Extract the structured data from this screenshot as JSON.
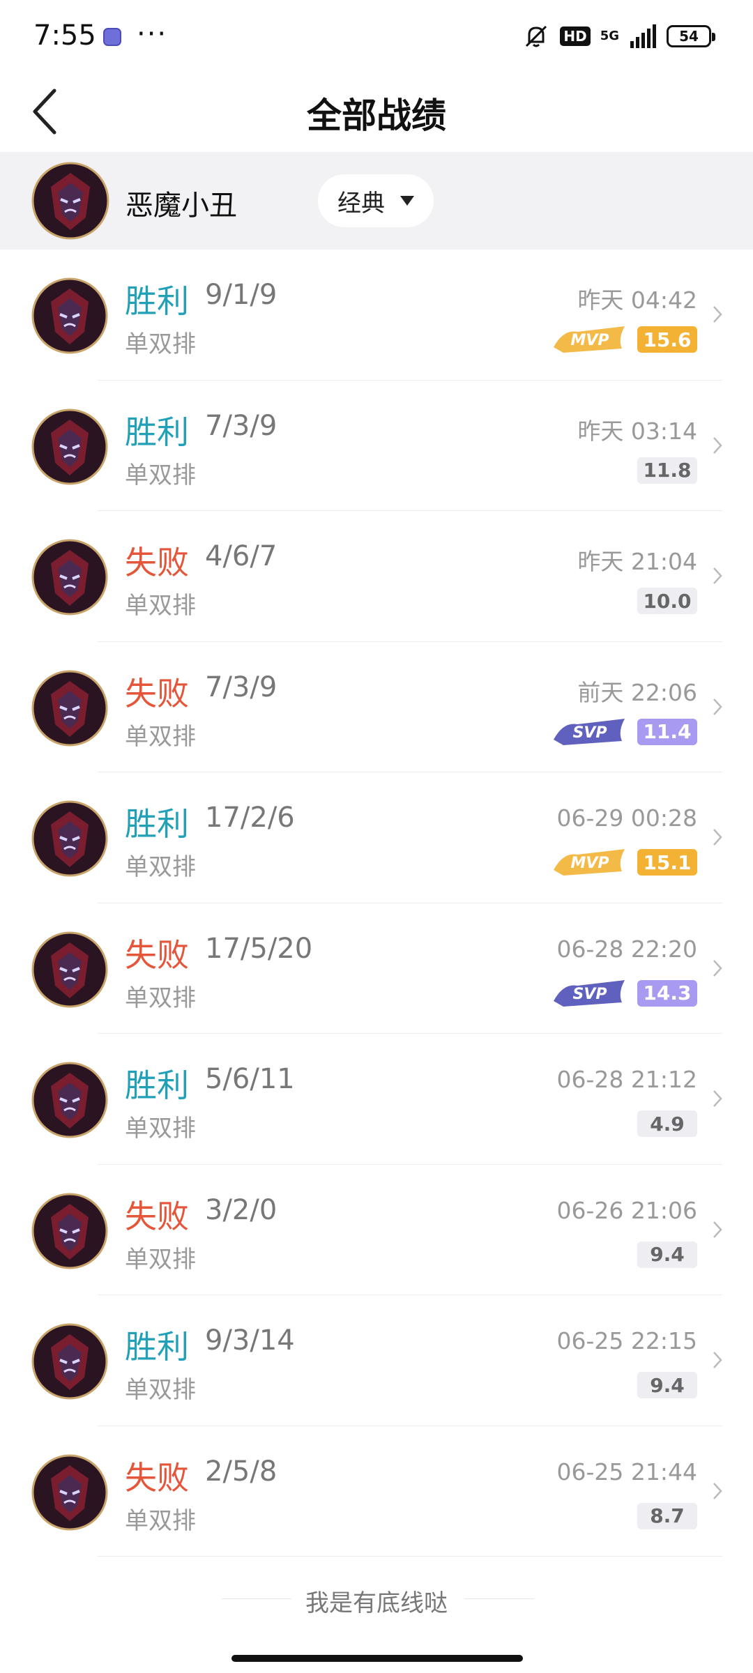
{
  "status_bar": {
    "time": "7:55",
    "hd": "HD",
    "network": "5G",
    "battery": "54"
  },
  "nav": {
    "title": "全部战绩"
  },
  "profile": {
    "name": "恶魔小丑",
    "mode_selector": "经典"
  },
  "colors": {
    "win": "#22a0b8",
    "loss": "#e4553a",
    "mvp": "#f3b234",
    "svp": "#a89af0"
  },
  "matches": [
    {
      "result": "胜利",
      "outcome": "win",
      "kda": "9/1/9",
      "mode": "单双排",
      "time": "昨天 04:42",
      "score": "15.6",
      "badge": "MVP"
    },
    {
      "result": "胜利",
      "outcome": "win",
      "kda": "7/3/9",
      "mode": "单双排",
      "time": "昨天 03:14",
      "score": "11.8",
      "badge": ""
    },
    {
      "result": "失败",
      "outcome": "loss",
      "kda": "4/6/7",
      "mode": "单双排",
      "time": "昨天 21:04",
      "score": "10.0",
      "badge": ""
    },
    {
      "result": "失败",
      "outcome": "loss",
      "kda": "7/3/9",
      "mode": "单双排",
      "time": "前天 22:06",
      "score": "11.4",
      "badge": "SVP"
    },
    {
      "result": "胜利",
      "outcome": "win",
      "kda": "17/2/6",
      "mode": "单双排",
      "time": "06-29 00:28",
      "score": "15.1",
      "badge": "MVP"
    },
    {
      "result": "失败",
      "outcome": "loss",
      "kda": "17/5/20",
      "mode": "单双排",
      "time": "06-28 22:20",
      "score": "14.3",
      "badge": "SVP"
    },
    {
      "result": "胜利",
      "outcome": "win",
      "kda": "5/6/11",
      "mode": "单双排",
      "time": "06-28 21:12",
      "score": "4.9",
      "badge": ""
    },
    {
      "result": "失败",
      "outcome": "loss",
      "kda": "3/2/0",
      "mode": "单双排",
      "time": "06-26 21:06",
      "score": "9.4",
      "badge": ""
    },
    {
      "result": "胜利",
      "outcome": "win",
      "kda": "9/3/14",
      "mode": "单双排",
      "time": "06-25 22:15",
      "score": "9.4",
      "badge": ""
    },
    {
      "result": "失败",
      "outcome": "loss",
      "kda": "2/5/8",
      "mode": "单双排",
      "time": "06-25 21:44",
      "score": "8.7",
      "badge": ""
    }
  ],
  "footer": {
    "text": "我是有底线哒"
  }
}
